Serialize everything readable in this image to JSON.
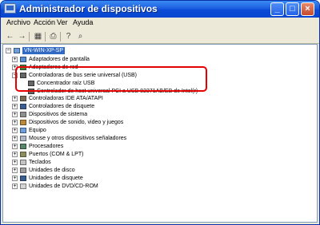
{
  "window": {
    "title": "Administrador de dispositivos"
  },
  "menu": [
    "Archivo",
    "Acción",
    "Ver",
    "Ayuda"
  ],
  "tree": {
    "root": "VN-WIN-XP-SP",
    "categories": [
      {
        "label": "Adaptadores de pantalla",
        "icon": "monitor-icon",
        "expanded": false
      },
      {
        "label": "Adaptadores de red",
        "icon": "network-adapter-icon",
        "expanded": false
      },
      {
        "label": "Controladoras de bus serie universal (USB)",
        "icon": "usb-icon",
        "expanded": true,
        "children": [
          "Concentrador raíz USB",
          "Controlador de host universal PCI a USB 82371AB/EB de Intel(r)"
        ]
      },
      {
        "label": "Controladoras IDE ATA/ATAPI",
        "icon": "ide-controller-icon",
        "expanded": false
      },
      {
        "label": "Controladores de disquete",
        "icon": "floppy-controller-icon",
        "expanded": false
      },
      {
        "label": "Dispositivos de sistema",
        "icon": "system-device-icon",
        "expanded": false
      },
      {
        "label": "Dispositivos de sonido, video y juegos",
        "icon": "sound-icon",
        "expanded": false
      },
      {
        "label": "Equipo",
        "icon": "computer-icon",
        "expanded": false
      },
      {
        "label": "Mouse y otros dispositivos señaladores",
        "icon": "mouse-icon",
        "expanded": false
      },
      {
        "label": "Procesadores",
        "icon": "processor-icon",
        "expanded": false
      },
      {
        "label": "Puertos (COM & LPT)",
        "icon": "port-icon",
        "expanded": false
      },
      {
        "label": "Teclados",
        "icon": "keyboard-icon",
        "expanded": false
      },
      {
        "label": "Unidades de disco",
        "icon": "disk-drive-icon",
        "expanded": false
      },
      {
        "label": "Unidades de disquete",
        "icon": "floppy-drive-icon",
        "expanded": false
      },
      {
        "label": "Unidades de DVD/CD-ROM",
        "icon": "dvd-icon",
        "expanded": false
      }
    ]
  },
  "colors": {
    "highlight": "#e60000",
    "titlebar": "#0a4bd6",
    "selection": "#316ac5"
  }
}
